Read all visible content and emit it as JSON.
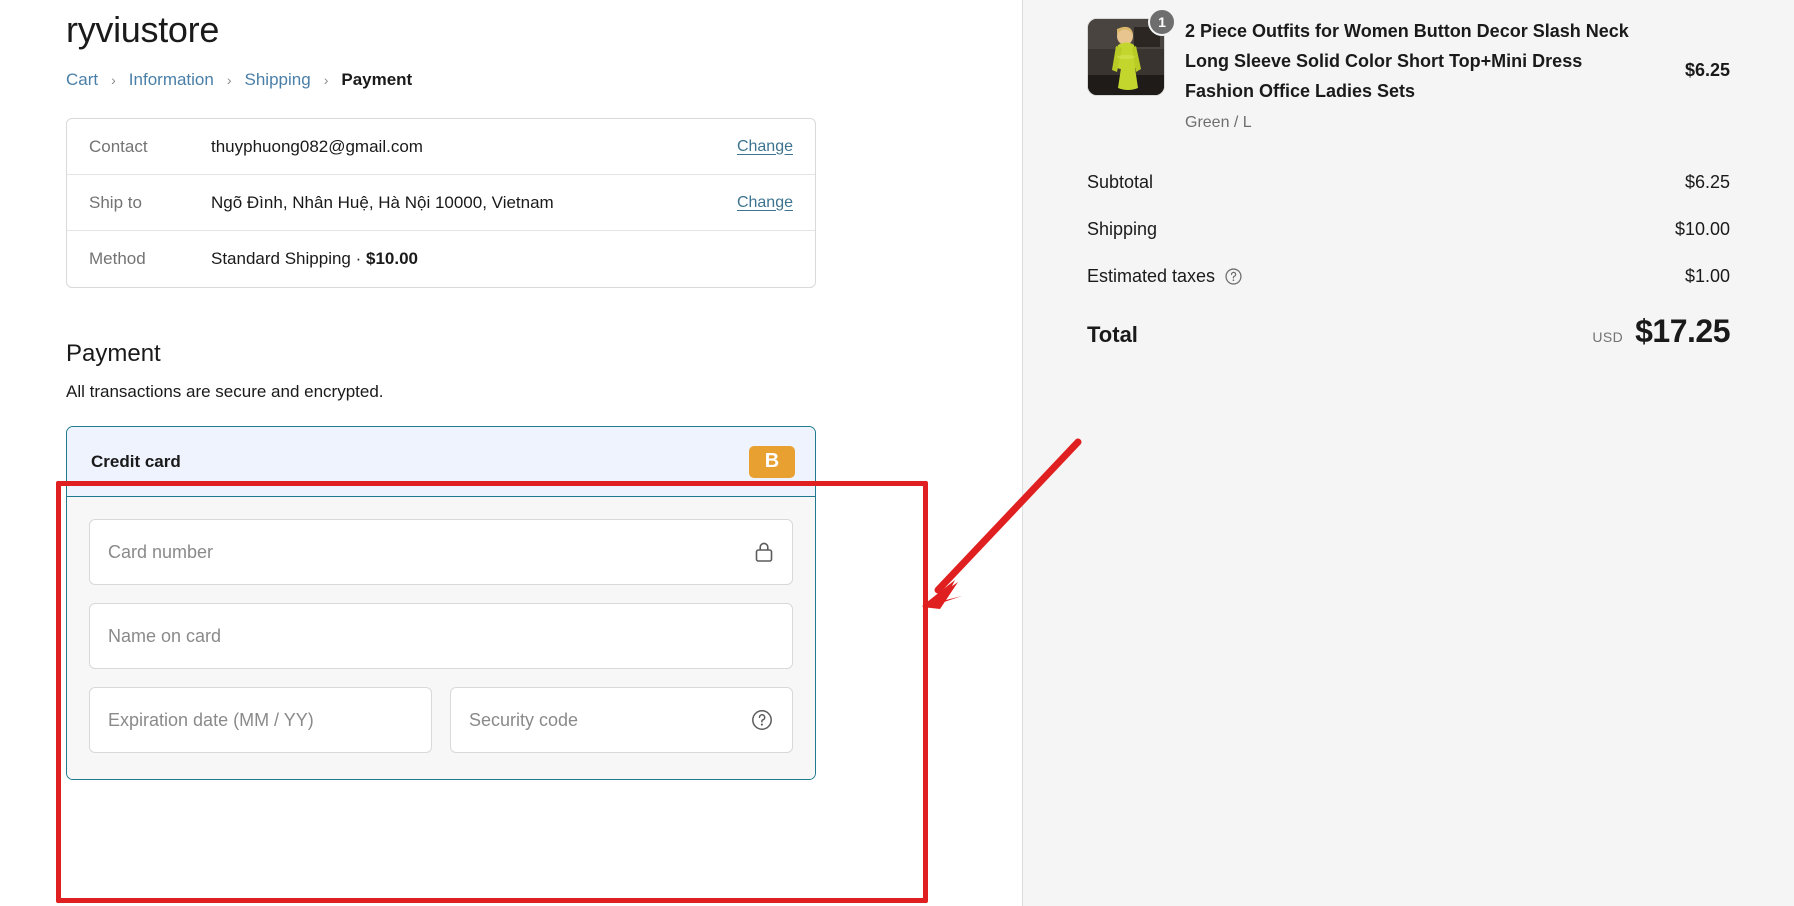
{
  "store": {
    "name": "ryviustore"
  },
  "breadcrumb": {
    "items": [
      {
        "label": "Cart",
        "current": false
      },
      {
        "label": "Information",
        "current": false
      },
      {
        "label": "Shipping",
        "current": false
      },
      {
        "label": "Payment",
        "current": true
      }
    ],
    "separator": "›"
  },
  "review": {
    "contact": {
      "label": "Contact",
      "value": "thuyphuong082@gmail.com",
      "action": "Change"
    },
    "ship_to": {
      "label": "Ship to",
      "value": "Ngõ Đình, Nhân Huệ, Hà Nội 10000, Vietnam",
      "action": "Change"
    },
    "method": {
      "label": "Method",
      "value_prefix": "Standard Shipping · ",
      "value_amount": "$10.00"
    }
  },
  "payment": {
    "heading": "Payment",
    "subtext": "All transactions are secure and encrypted.",
    "method_title": "Credit card",
    "brand_badge": "B",
    "fields": {
      "card_number": {
        "placeholder": "Card number",
        "value": "",
        "icon": "lock-icon"
      },
      "name_on_card": {
        "placeholder": "Name on card",
        "value": ""
      },
      "expiration": {
        "placeholder": "Expiration date (MM / YY)",
        "value": ""
      },
      "security_code": {
        "placeholder": "Security code",
        "value": "",
        "icon": "help-icon"
      }
    }
  },
  "summary": {
    "item": {
      "title": "2 Piece Outfits for Women Button Decor Slash Neck Long Sleeve Solid Color Short Top+Mini Dress Fashion Office Ladies Sets",
      "variant": "Green / L",
      "price": "$6.25",
      "quantity": "1"
    },
    "lines": [
      {
        "label": "Subtotal",
        "value": "$6.25",
        "has_info": false
      },
      {
        "label": "Shipping",
        "value": "$10.00",
        "has_info": false
      },
      {
        "label": "Estimated taxes",
        "value": "$1.00",
        "has_info": true
      }
    ],
    "total": {
      "label": "Total",
      "currency": "USD",
      "value": "$17.25"
    }
  },
  "colors": {
    "accent_link": "#4a7fa8",
    "change_link": "#3d7490",
    "selected_border": "#1e7a8c",
    "selected_bg": "#eef3fd",
    "brand_badge_bg": "#e8a030",
    "annotation": "#e02020",
    "summary_bg": "#f5f5f5"
  }
}
